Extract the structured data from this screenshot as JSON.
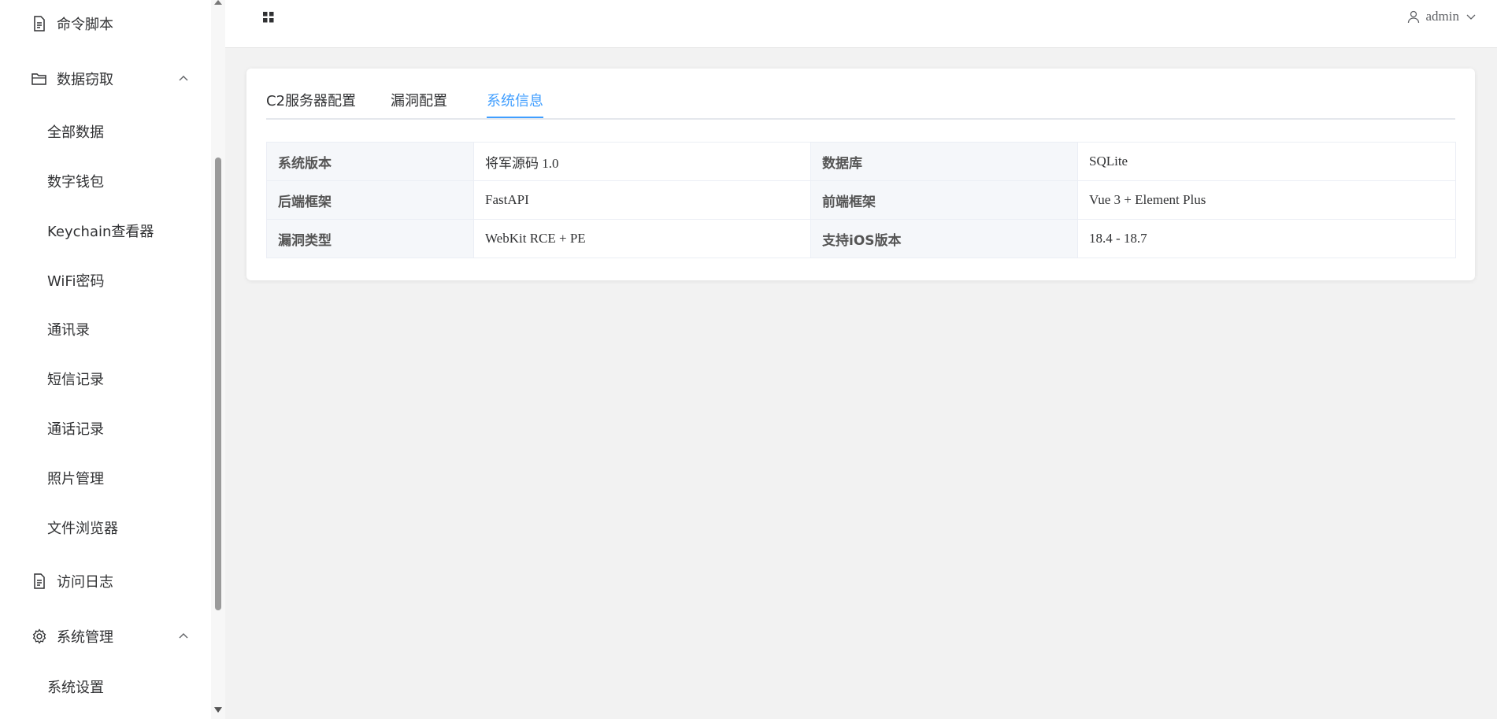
{
  "sidebar": {
    "menu": [
      {
        "label": "命令脚本",
        "icon": "document-icon",
        "has_arrow": false
      },
      {
        "label": "数据窃取",
        "icon": "folder-icon",
        "has_arrow": true
      },
      {
        "label": "访问日志",
        "icon": "document-icon",
        "has_arrow": false
      },
      {
        "label": "系统管理",
        "icon": "gear-icon",
        "has_arrow": true
      }
    ],
    "data_sub": [
      "全部数据",
      "数字钱包",
      "Keychain查看器",
      "WiFi密码",
      "通讯录",
      "短信记录",
      "通话记录",
      "照片管理",
      "文件浏览器"
    ],
    "system_sub": [
      "系统设置"
    ]
  },
  "header": {
    "menu_icon": "grid-icon",
    "user_icon": "user-icon",
    "username": "admin",
    "dropdown_icon": "chevron-down-icon"
  },
  "tabs": [
    {
      "label": "C2服务器配置"
    },
    {
      "label": "漏洞配置"
    },
    {
      "label": "系统信息"
    }
  ],
  "active_tab": "系统信息",
  "info": {
    "rows": [
      {
        "l1": "系统版本",
        "v1": "将军源码 1.0",
        "l2": "数据库",
        "v2": "SQLite"
      },
      {
        "l1": "后端框架",
        "v1": "FastAPI",
        "l2": "前端框架",
        "v2": "Vue 3 + Element Plus"
      },
      {
        "l1": "漏洞类型",
        "v1": "WebKit RCE + PE",
        "l2": "支持iOS版本",
        "v2": "18.4 - 18.7"
      }
    ]
  },
  "colors": {
    "accent": "#409eff",
    "background": "#f2f2f2",
    "label_bg": "#f5f7fa"
  }
}
